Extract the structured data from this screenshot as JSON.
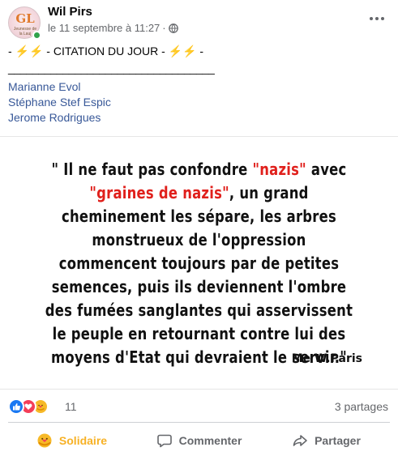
{
  "post": {
    "author": "Wil Pirs",
    "timestamp": "le 11 septembre à 11:27",
    "separator": "·",
    "privacy_icon": "globe-icon",
    "avatar": {
      "logo_text": "GL",
      "sub_text": "Jeunesse de la Lauj"
    },
    "citation_line": "- ⚡⚡ - CITATION DU JOUR - ⚡⚡ -",
    "underline": "__________________________________",
    "mentions": [
      "Marianne Evol",
      "Stéphane Stef Espic",
      "Jerome Rodrigues"
    ],
    "quote": {
      "open": "\" Il ne faut pas confondre ",
      "red1": "\"nazis\"",
      "mid1": " avec ",
      "red2": "\"graines de nazis\"",
      "rest": ", un grand cheminement les sépare, les arbres monstrueux de l'oppression commencent toujours par de petites semences, puis ils deviennent l'ombre des fumées sanglantes qui asservissent le peuple en retournant contre lui des moyens d'Etat qui devraient le servir.\"",
      "signature": "Me W.Paris"
    },
    "reactions": {
      "count": "11",
      "shares": "3 partages"
    },
    "actions": {
      "react": "Solidaire",
      "comment": "Commenter",
      "share": "Partager"
    },
    "colors": {
      "link": "#385898",
      "accent_red": "#e0201c",
      "react_active": "#f7b125",
      "online": "#31a24c"
    }
  }
}
